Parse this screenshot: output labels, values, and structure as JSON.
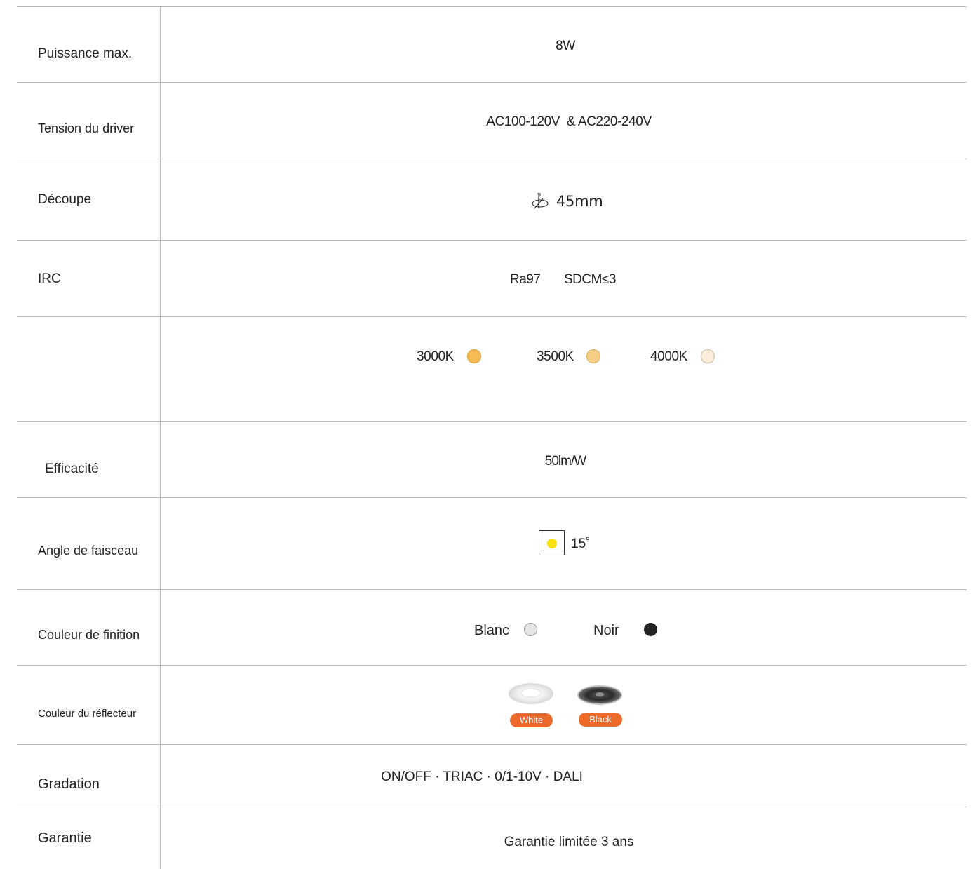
{
  "rows": [
    {
      "label": "Puissance max.",
      "value": "8W"
    },
    {
      "label": "Tension du driver",
      "value": "AC100-120V  & AC220-240V"
    },
    {
      "label": "Découpe",
      "value": "45mm"
    },
    {
      "label": "IRC",
      "value_a": "Ra97",
      "value_b": "SDCM≤3"
    },
    {
      "label": "",
      "temps": [
        {
          "text": "3000K",
          "color": "#f6bb55"
        },
        {
          "text": "3500K",
          "color": "#f4cf85"
        },
        {
          "text": "4000K",
          "color": "#fbeedd"
        }
      ]
    },
    {
      "label": "Efficacité",
      "value": "50lm/W"
    },
    {
      "label": "Angle de faisceau",
      "value": "15˚"
    },
    {
      "label": "Couleur de finition",
      "finishes": [
        {
          "text": "Blanc",
          "color": "#e6e6e6"
        },
        {
          "text": "Noir",
          "color": "#222222"
        }
      ]
    },
    {
      "label": "Couleur du réflecteur",
      "reflectors": [
        {
          "text": "White"
        },
        {
          "text": "Black"
        }
      ]
    },
    {
      "label": "Gradation",
      "value": "ON/OFF · TRIAC · 0/1-10V · DALI"
    },
    {
      "label": "Garantie",
      "value": "Garantie limitée 3 ans"
    }
  ],
  "colors": {
    "accent": "#ec6a2a",
    "beam": "#fbe20a",
    "rule": "#b9b9b9"
  }
}
